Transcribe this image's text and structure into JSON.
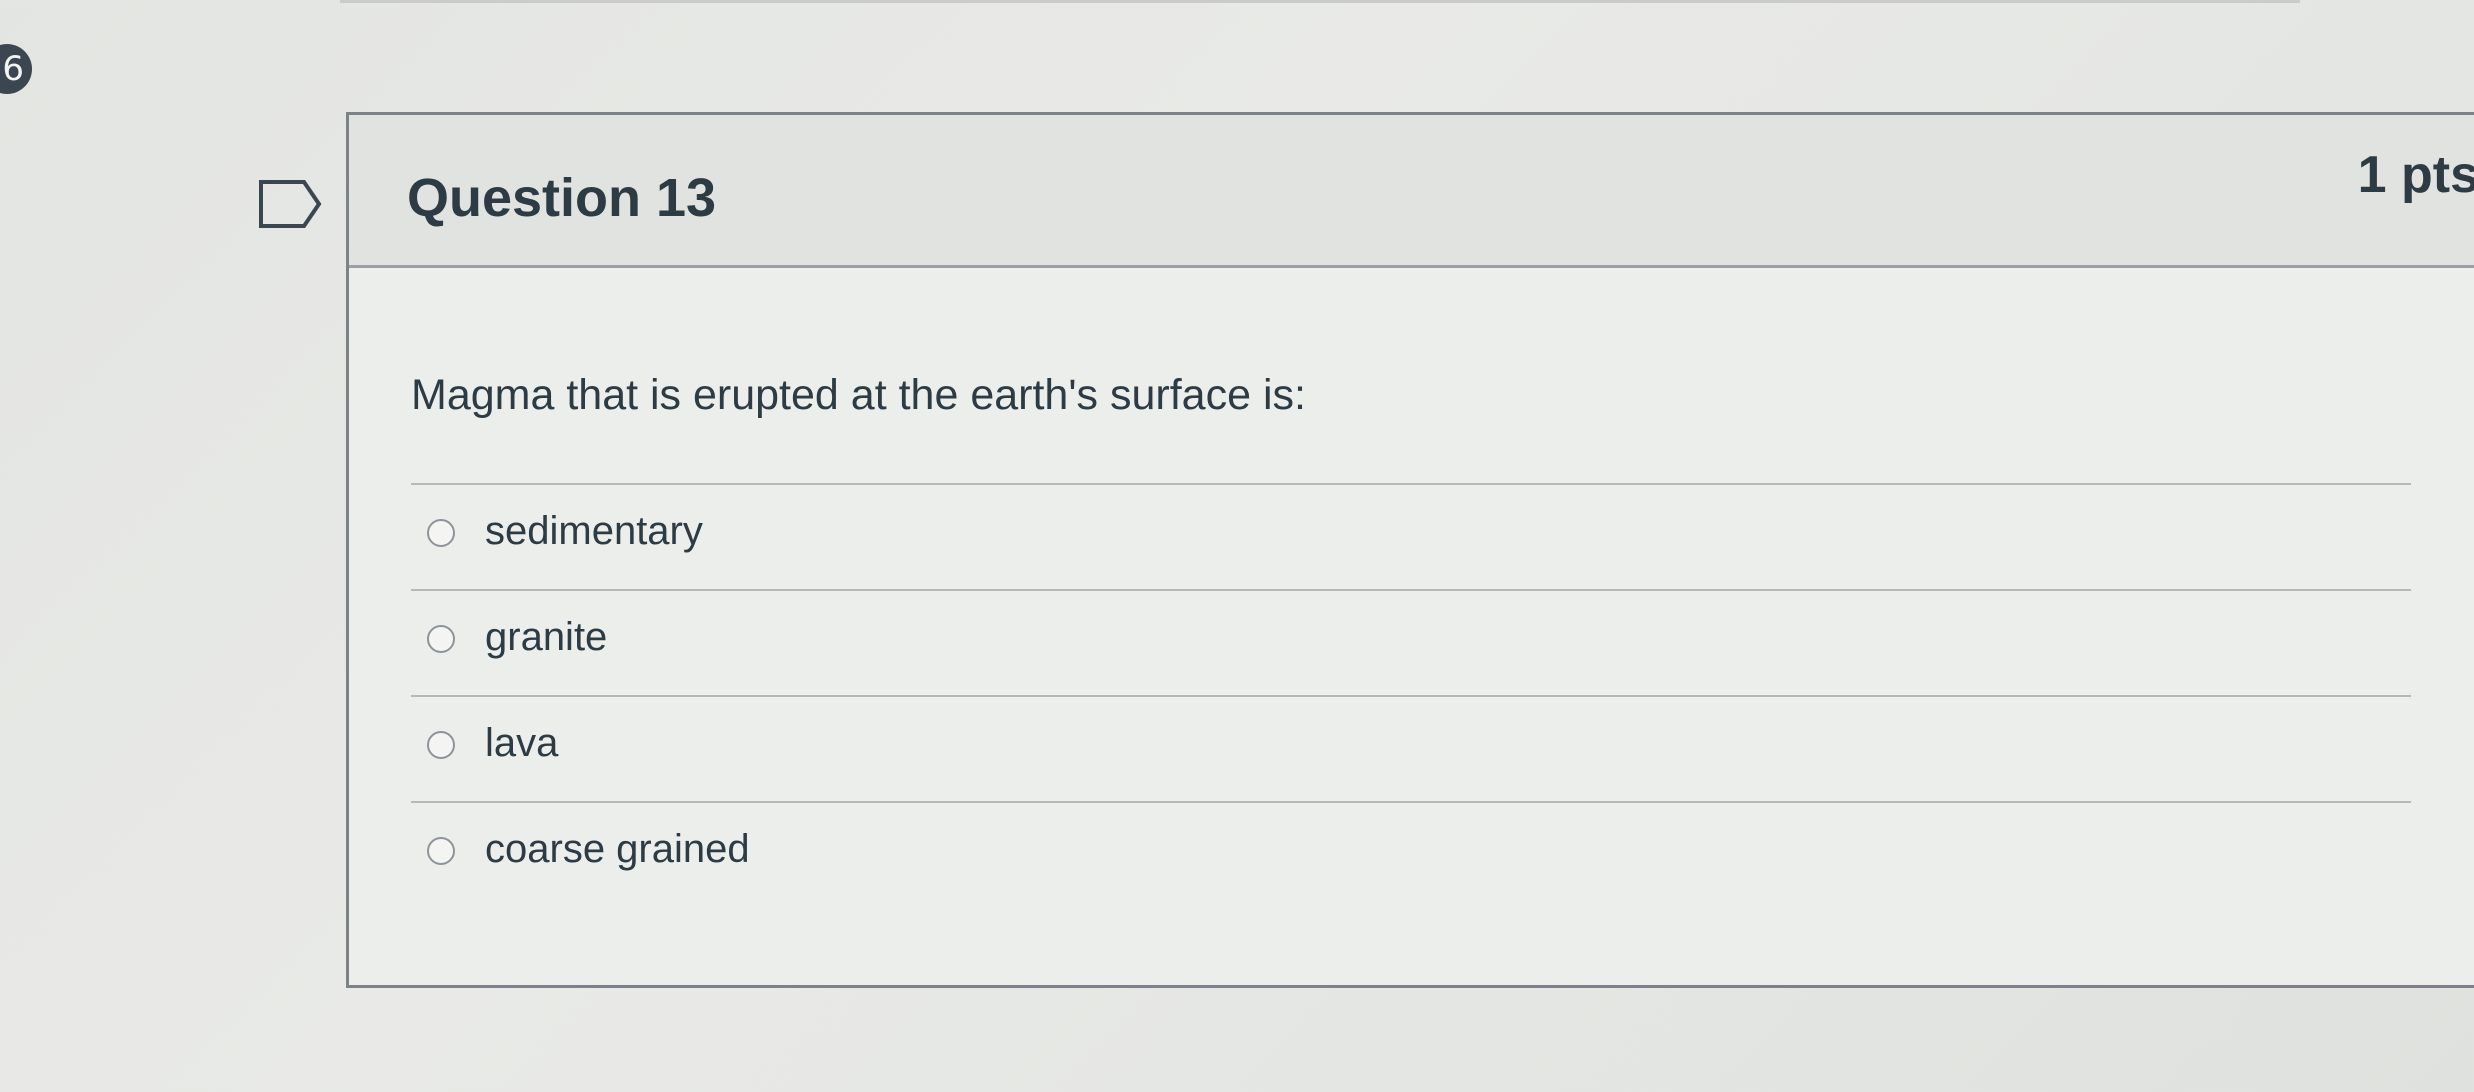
{
  "badge": {
    "number": "6"
  },
  "question": {
    "title": "Question 13",
    "points": "1 pts",
    "text": "Magma that is erupted at the earth's surface is:",
    "flag_icon": "flag-outline-icon",
    "answers": [
      {
        "label": "sedimentary",
        "selected": false
      },
      {
        "label": "granite",
        "selected": false
      },
      {
        "label": "lava",
        "selected": false
      },
      {
        "label": "coarse grained",
        "selected": false
      }
    ]
  },
  "colors": {
    "text": "#2d3b45",
    "card_border": "#7c8288",
    "header_bg": "#e1e3e0",
    "card_bg": "#eceeeb"
  }
}
